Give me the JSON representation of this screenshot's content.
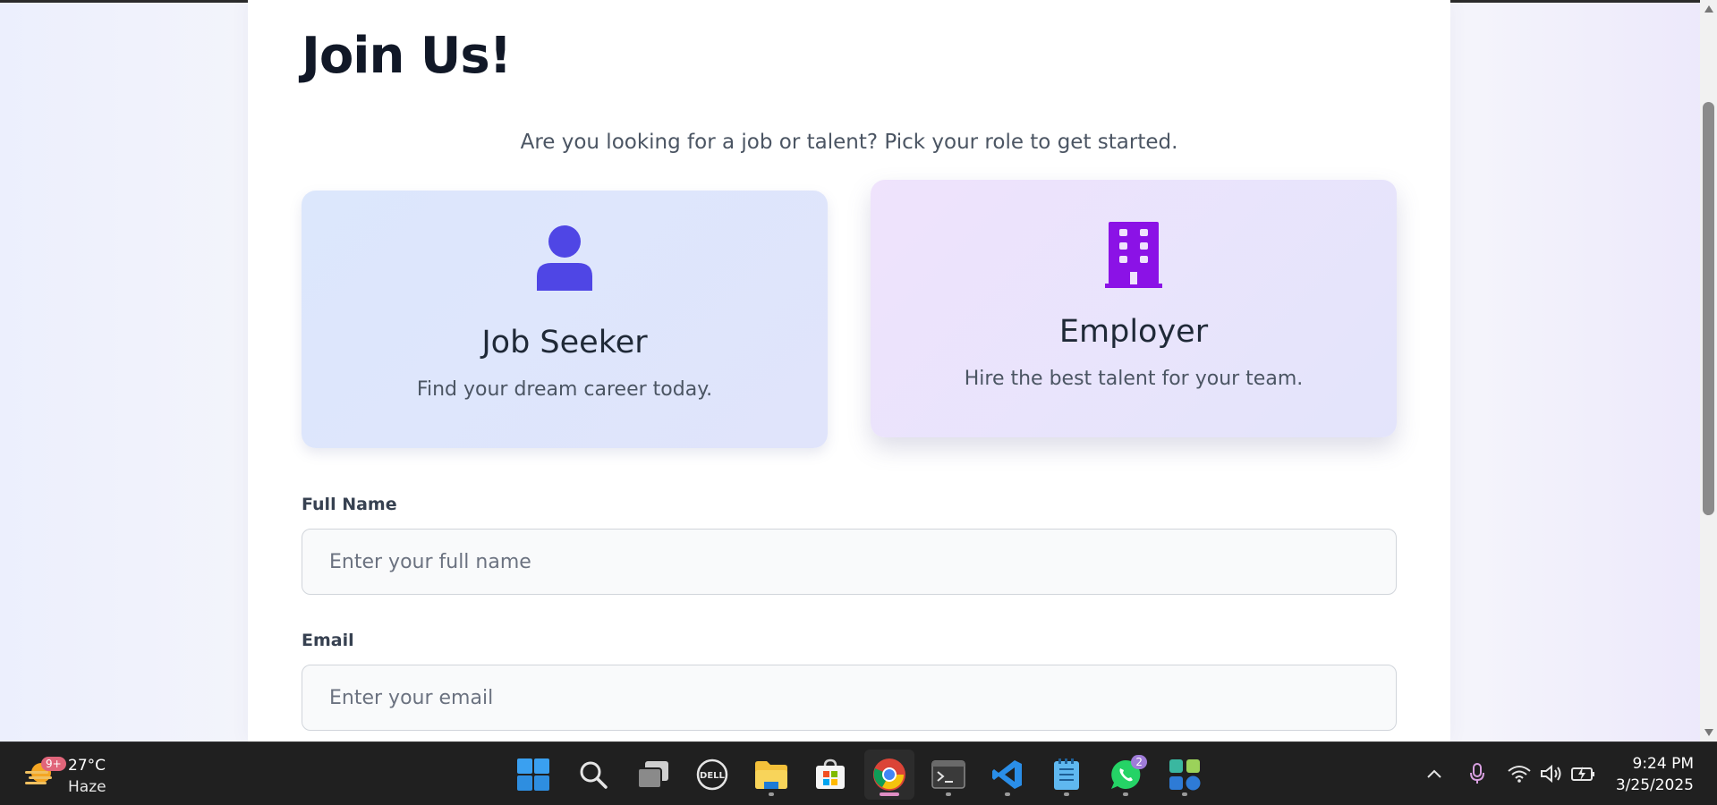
{
  "page": {
    "title": "Join Us!",
    "subtitle": "Are you looking for a job or talent? Pick your role to get started."
  },
  "roles": [
    {
      "title": "Job Seeker",
      "description": "Find your dream career today.",
      "icon": "user-icon",
      "color": "#4f46e5"
    },
    {
      "title": "Employer",
      "description": "Hire the best talent for your team.",
      "icon": "building-icon",
      "color": "#8b12e6"
    }
  ],
  "form": {
    "full_name": {
      "label": "Full Name",
      "placeholder": "Enter your full name",
      "value": ""
    },
    "email": {
      "label": "Email",
      "placeholder": "Enter your email",
      "value": ""
    }
  },
  "taskbar": {
    "weather": {
      "temp": "27°C",
      "condition": "Haze",
      "badge": "9+"
    },
    "apps": [
      {
        "name": "start-icon"
      },
      {
        "name": "search-icon"
      },
      {
        "name": "task-view-icon"
      },
      {
        "name": "dell-icon",
        "label": "DELL"
      },
      {
        "name": "file-explorer-icon"
      },
      {
        "name": "microsoft-store-icon"
      },
      {
        "name": "chrome-icon",
        "active": true
      },
      {
        "name": "terminal-icon"
      },
      {
        "name": "vscode-icon"
      },
      {
        "name": "notepad-icon"
      },
      {
        "name": "whatsapp-icon",
        "badge": "2"
      },
      {
        "name": "app-grid-icon"
      }
    ],
    "clock": {
      "time": "9:24 PM",
      "date": "3/25/2025"
    }
  }
}
